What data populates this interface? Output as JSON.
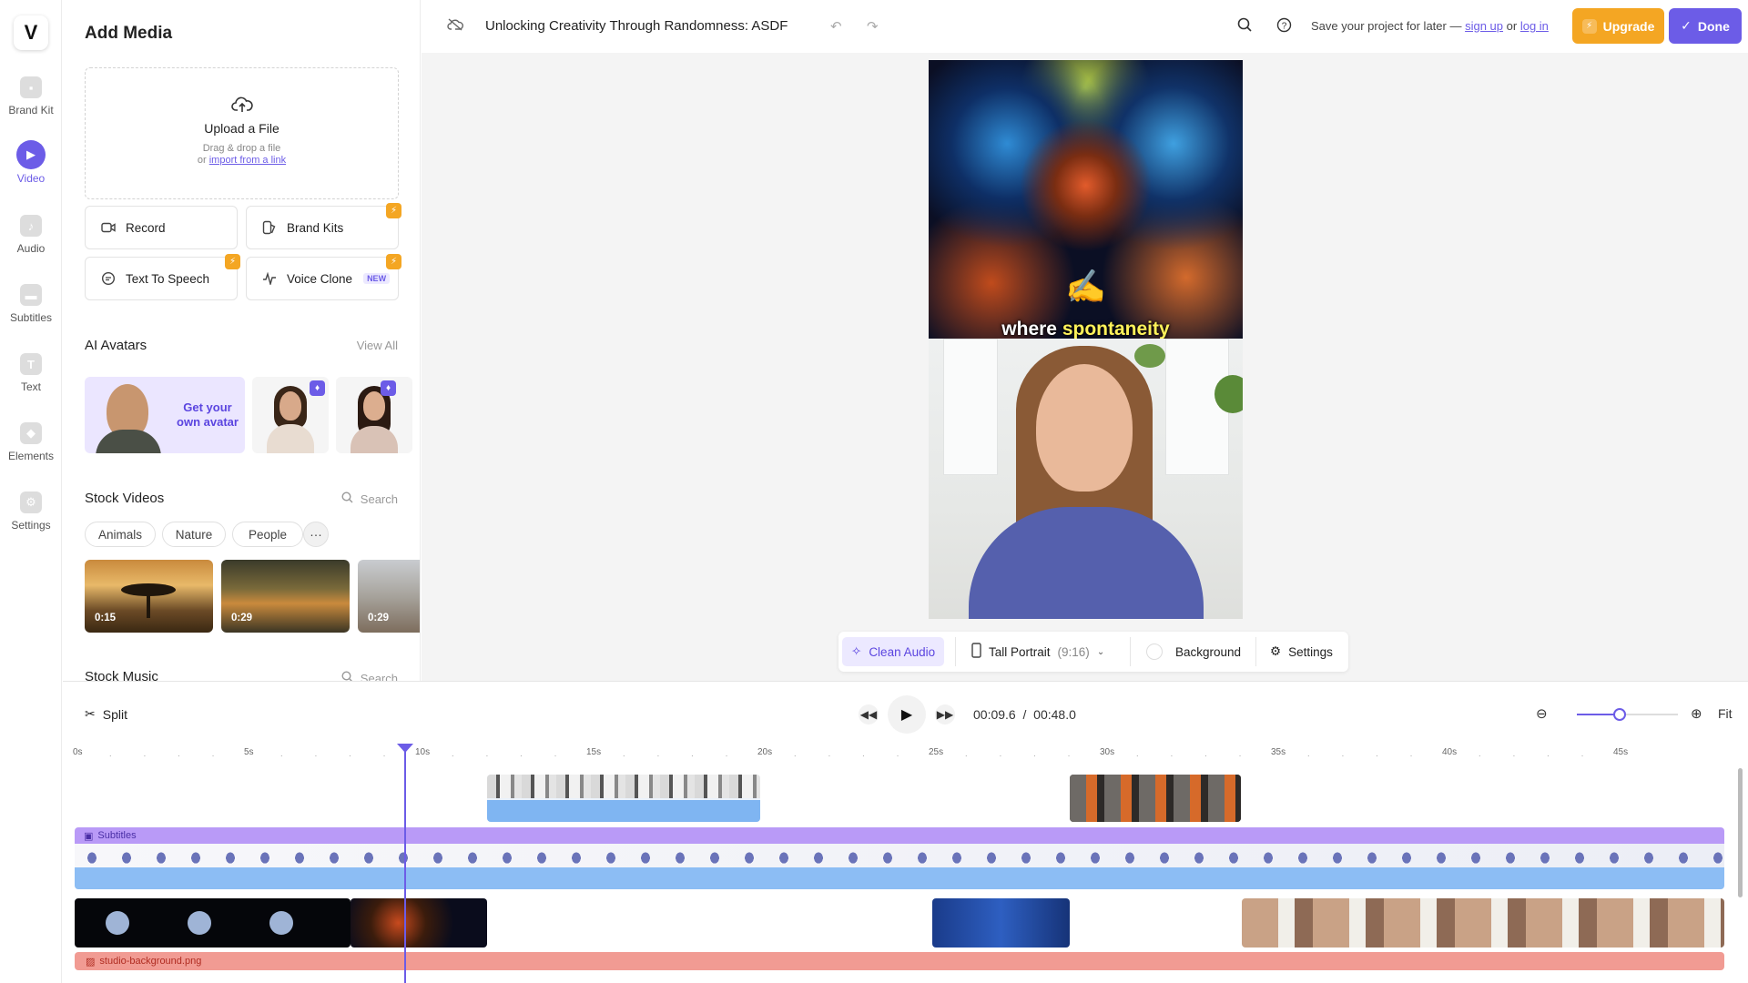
{
  "colors": {
    "accent": "#6c5ce7",
    "upgrade": "#f4a623",
    "subtitles": "#b99af7",
    "background_track": "#f19b93",
    "waveform": "#7fb5f2"
  },
  "app": {
    "logo": "V"
  },
  "nav": [
    {
      "label": "Brand Kit",
      "icon": "brand-kit-icon"
    },
    {
      "label": "Video",
      "icon": "video-icon",
      "active": true
    },
    {
      "label": "Audio",
      "icon": "audio-icon"
    },
    {
      "label": "Subtitles",
      "icon": "subtitles-icon"
    },
    {
      "label": "Text",
      "icon": "text-icon"
    },
    {
      "label": "Elements",
      "icon": "elements-icon"
    },
    {
      "label": "Settings",
      "icon": "settings-icon"
    }
  ],
  "media": {
    "title": "Add Media",
    "upload": {
      "title": "Upload a File",
      "hint": "Drag & drop a file",
      "or": "or",
      "link": "import from a link"
    },
    "tools": {
      "record": "Record",
      "brand_kits": "Brand Kits",
      "tts": "Text To Speech",
      "voice_clone": "Voice Clone",
      "new_tag": "NEW"
    },
    "avatars": {
      "title": "AI Avatars",
      "view_all": "View All",
      "own_avatar": "Get your own avatar"
    },
    "stock_videos": {
      "title": "Stock Videos",
      "search": "Search",
      "chips": [
        "Animals",
        "Nature",
        "People"
      ],
      "more": "···",
      "thumbs": [
        "0:15",
        "0:29",
        "0:29"
      ]
    },
    "stock_music": {
      "title": "Stock Music",
      "search": "Search"
    }
  },
  "topbar": {
    "project_title": "Unlocking Creativity Through Randomness: ASDF",
    "save_prefix": "Save your project for later —",
    "sign_up": "sign up",
    "or": "or",
    "log_in": "log in",
    "upgrade": "Upgrade",
    "done": "Done"
  },
  "preview": {
    "caption_plain": "where",
    "caption_highlight": "spontaneity",
    "emoji": "✍️"
  },
  "preview_toolbar": {
    "clean_audio": "Clean Audio",
    "aspect": "Tall Portrait",
    "aspect_ratio": "(9:16)",
    "background": "Background",
    "settings": "Settings"
  },
  "timeline": {
    "split": "Split",
    "current_time": "00:09.6",
    "separator": "/",
    "total_time": "00:48.0",
    "fit": "Fit",
    "zoom_level": 0.42,
    "ruler": [
      "0s",
      "5s",
      "10s",
      "15s",
      "20s",
      "25s",
      "30s",
      "35s",
      "40s",
      "45s"
    ],
    "subtitles_label": "Subtitles",
    "background_label": "studio-background.png"
  }
}
